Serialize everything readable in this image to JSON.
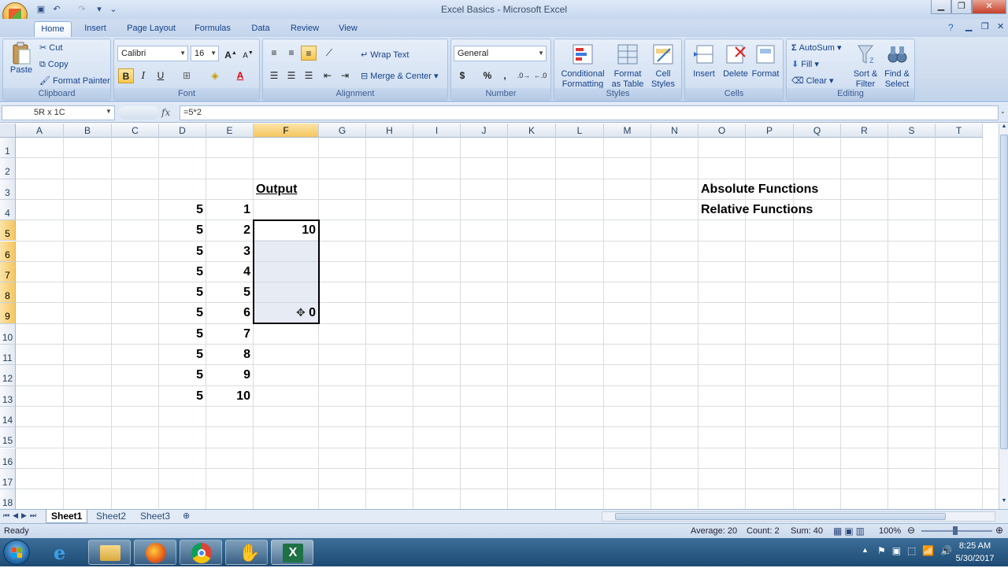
{
  "window": {
    "title": "Excel Basics - Microsoft Excel"
  },
  "tabs": [
    "Home",
    "Insert",
    "Page Layout",
    "Formulas",
    "Data",
    "Review",
    "View"
  ],
  "clipboard": {
    "paste": "Paste",
    "cut": "Cut",
    "copy": "Copy",
    "format_painter": "Format Painter",
    "label": "Clipboard"
  },
  "font": {
    "name": "Calibri",
    "size": "16",
    "bold": "B",
    "italic": "I",
    "underline": "U",
    "label": "Font"
  },
  "alignment": {
    "wrap_text": "Wrap Text",
    "merge_center": "Merge & Center",
    "label": "Alignment"
  },
  "number": {
    "format": "General",
    "currency": "$",
    "percent": "%",
    "comma": ",",
    "label": "Number"
  },
  "styles": {
    "conditional": [
      "Conditional",
      "Formatting"
    ],
    "format_table": [
      "Format",
      "as Table"
    ],
    "cell_styles": [
      "Cell",
      "Styles"
    ],
    "label": "Styles"
  },
  "cells": {
    "insert": "Insert",
    "delete": "Delete",
    "format": "Format",
    "label": "Cells"
  },
  "editing": {
    "autosum": "AutoSum",
    "fill": "Fill",
    "clear": "Clear",
    "sort": [
      "Sort &",
      "Filter"
    ],
    "find": [
      "Find &",
      "Select"
    ],
    "label": "Editing"
  },
  "formula_bar": {
    "name_box": "5R x 1C",
    "fx": "fx",
    "formula": "=5*2"
  },
  "columns": [
    "A",
    "B",
    "C",
    "D",
    "E",
    "F",
    "G",
    "H",
    "I",
    "J",
    "K",
    "L",
    "M",
    "N",
    "O",
    "P",
    "Q",
    "R",
    "S",
    "T"
  ],
  "rows": [
    "1",
    "2",
    "3",
    "4",
    "5",
    "6",
    "7",
    "8",
    "9",
    "10",
    "11",
    "12",
    "13",
    "14",
    "15",
    "16",
    "17",
    "18"
  ],
  "cells_data": {
    "F3": "Output",
    "D4": "5",
    "E4": "1",
    "D5": "5",
    "E5": "2",
    "F5": "10",
    "D6": "5",
    "E6": "3",
    "D7": "5",
    "E7": "4",
    "D8": "5",
    "E8": "5",
    "D9": "5",
    "E9": "6",
    "F9": "0",
    "D10": "5",
    "E10": "7",
    "D11": "5",
    "E11": "8",
    "D12": "5",
    "E12": "9",
    "D13": "5",
    "E13": "10",
    "O3": "Absolute Functions",
    "O4": "Relative Functions"
  },
  "sheets": [
    "Sheet1",
    "Sheet2",
    "Sheet3"
  ],
  "status": {
    "ready": "Ready",
    "average": "Average: 20",
    "count": "Count: 2",
    "sum": "Sum: 40",
    "zoom": "100%"
  },
  "clock": {
    "time": "8:25 AM",
    "date": "5/30/2017"
  }
}
